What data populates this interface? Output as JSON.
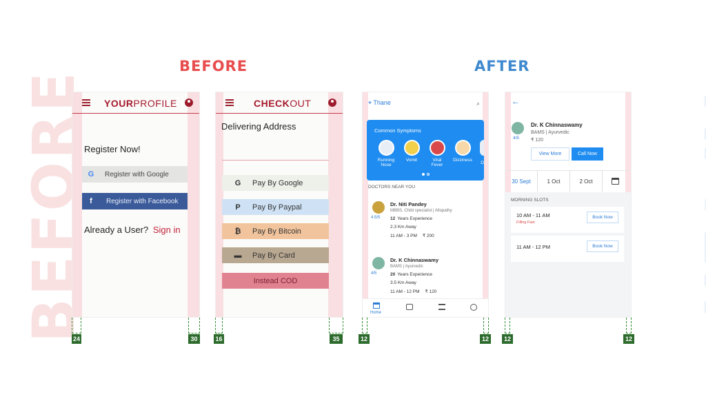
{
  "watermarks": {
    "left": "BEFORE",
    "right": "AFTER"
  },
  "headings": {
    "before": "BEFORE",
    "after": "AFTER"
  },
  "profile": {
    "brand_bold": "YOUR",
    "brand_rest": "PROFILE",
    "register_title": "Register Now!",
    "google_button": "Register with Google",
    "facebook_button": "Register with Facebook",
    "already_user": "Already a User?",
    "sign_in": "Sign in",
    "google_glyph": "G",
    "facebook_glyph": "f"
  },
  "checkout": {
    "brand_bold": "CHECK",
    "brand_rest": "OUT",
    "delivering": "Delivering Address",
    "options": [
      {
        "label": "Pay By Google",
        "icon": "google-icon",
        "glyph": "G",
        "bg": "#eef0ea"
      },
      {
        "label": "Pay By Paypal",
        "icon": "paypal-icon",
        "glyph": "P",
        "bg": "#cfe2f5"
      },
      {
        "label": "Pay By Bitcoin",
        "icon": "bitcoin-icon",
        "glyph": "₿",
        "bg": "#f1c49d"
      },
      {
        "label": "Pay By Card",
        "icon": "card-icon",
        "glyph": "▬",
        "bg": "#b9a891"
      },
      {
        "label": "Instead COD",
        "icon": "",
        "glyph": "",
        "bg": "#e18291"
      }
    ]
  },
  "home": {
    "location": "Thane",
    "symptoms_title": "Common Symptoms",
    "symptoms": [
      {
        "label_1": "Running",
        "label_2": "Nose",
        "color": "#e8eef6"
      },
      {
        "label_1": "Vomit",
        "label_2": "",
        "color": "#f2d04a"
      },
      {
        "label_1": "Viral",
        "label_2": "Fever",
        "color": "#d9484b"
      },
      {
        "label_1": "Dizziness",
        "label_2": "",
        "color": "#f7d8a8"
      }
    ],
    "symptom_partial": "D",
    "section_title": "DOCTORS NEAR YOU",
    "doctors": [
      {
        "name": "Dr. Niti Pandey",
        "spec": "MBBS, Child specialist | Allopathy",
        "exp_bold": "12",
        "exp_rest": "Years Experience",
        "distance": "2.3 Km Away",
        "time": "11 AM - 3 PM",
        "fee": "₹ 200",
        "rating": "4.5/5"
      },
      {
        "name": "Dr. K Chinnaswamy",
        "spec": "BAMS | Ayurvedic",
        "exp_bold": "20",
        "exp_rest": "Years Experience",
        "distance": "3.5 Km Away",
        "time": "11 AM - 12 PM",
        "fee": "₹ 120",
        "rating": "4/5"
      }
    ],
    "nav_home": "Home"
  },
  "detail": {
    "name": "Dr. K Chinnaswamy",
    "spec": "BAMS | Ayurvedic",
    "fee": "₹ 120",
    "rating": "4/5",
    "view_more": "View More",
    "call_now": "Call Now",
    "dates": [
      "30 Sept",
      "1 Oct",
      "2 Oct"
    ],
    "slots_title": "MORNING SLOTS",
    "slots": [
      {
        "time": "10 AM - 11 AM",
        "note": "Filling Fast",
        "book": "Book Now"
      },
      {
        "time": "11 AM - 12 PM",
        "note": "",
        "book": "Book Now"
      }
    ]
  },
  "guides": {
    "profile_left": "24",
    "profile_right": "30",
    "checkout_left": "16",
    "checkout_right": "35",
    "home_left": "12",
    "home_right": "12",
    "detail_left": "12",
    "detail_right": "12"
  },
  "colors": {
    "before_accent": "#e84c4c",
    "after_accent": "#3f89cf",
    "brand_red": "#a5192c",
    "primary_blue": "#2a7bd6",
    "guide_green": "#2d6b2d"
  }
}
